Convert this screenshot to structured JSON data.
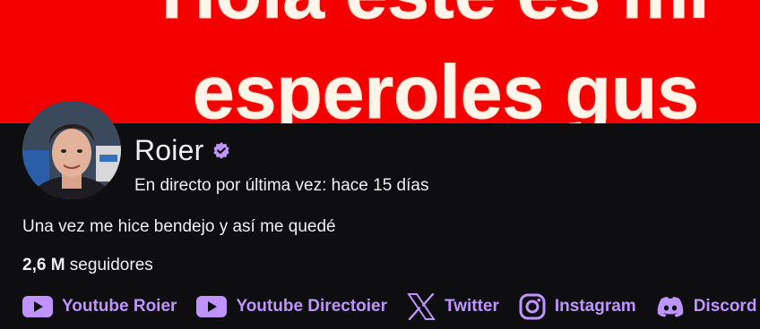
{
  "banner": {
    "line1": "Hola este es mi",
    "line2": "esperoles gus"
  },
  "profile": {
    "name": "Roier",
    "verified": true,
    "last_live": "En directo por última vez: hace 15 días",
    "bio": "Una vez me hice bendejo y así me quedé",
    "followers_count": "2,6 M",
    "followers_label": " seguidores"
  },
  "links": [
    {
      "label": "Youtube Roier",
      "icon": "youtube-icon"
    },
    {
      "label": "Youtube Directoier",
      "icon": "youtube-icon"
    },
    {
      "label": "Twitter",
      "icon": "x-icon"
    },
    {
      "label": "Instagram",
      "icon": "instagram-icon"
    },
    {
      "label": "Discord",
      "icon": "discord-icon"
    }
  ],
  "colors": {
    "banner": "#f50000",
    "background": "#0e0e10",
    "accent": "#bf94ff",
    "text": "#efeff1"
  }
}
